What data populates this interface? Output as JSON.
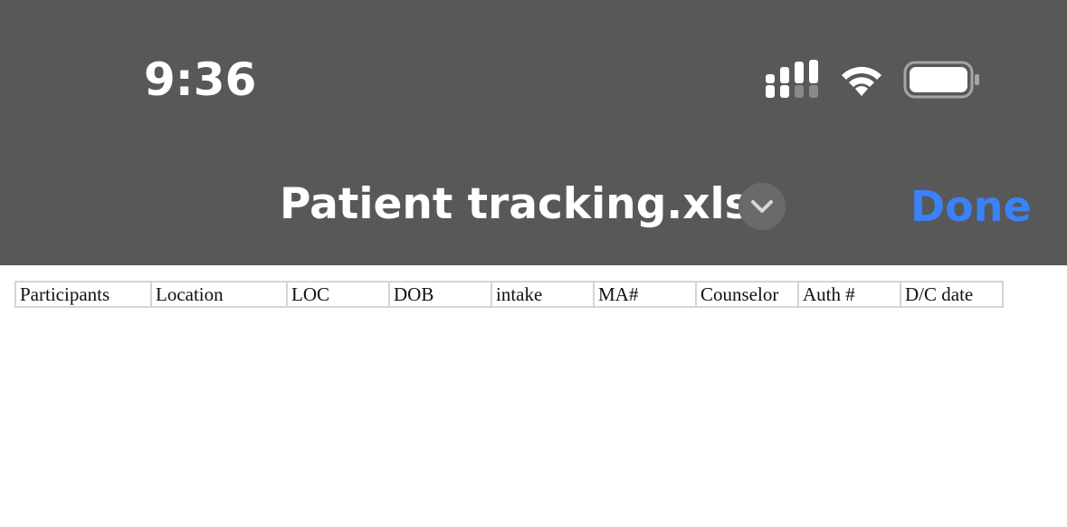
{
  "status_bar": {
    "time": "9:36",
    "signal_icon": "cellular-signal-icon",
    "wifi_icon": "wifi-icon",
    "battery_icon": "battery-icon"
  },
  "nav": {
    "title": "Patient tracking.xlsx",
    "title_menu_icon": "chevron-down-icon",
    "done_label": "Done",
    "done_color": "#3a82f7",
    "bar_color": "#585858"
  },
  "sheet": {
    "headers": [
      "Participants",
      "Location",
      "LOC",
      "DOB",
      "intake",
      "MA#",
      "Counselor",
      "Auth #",
      "D/C date"
    ]
  }
}
